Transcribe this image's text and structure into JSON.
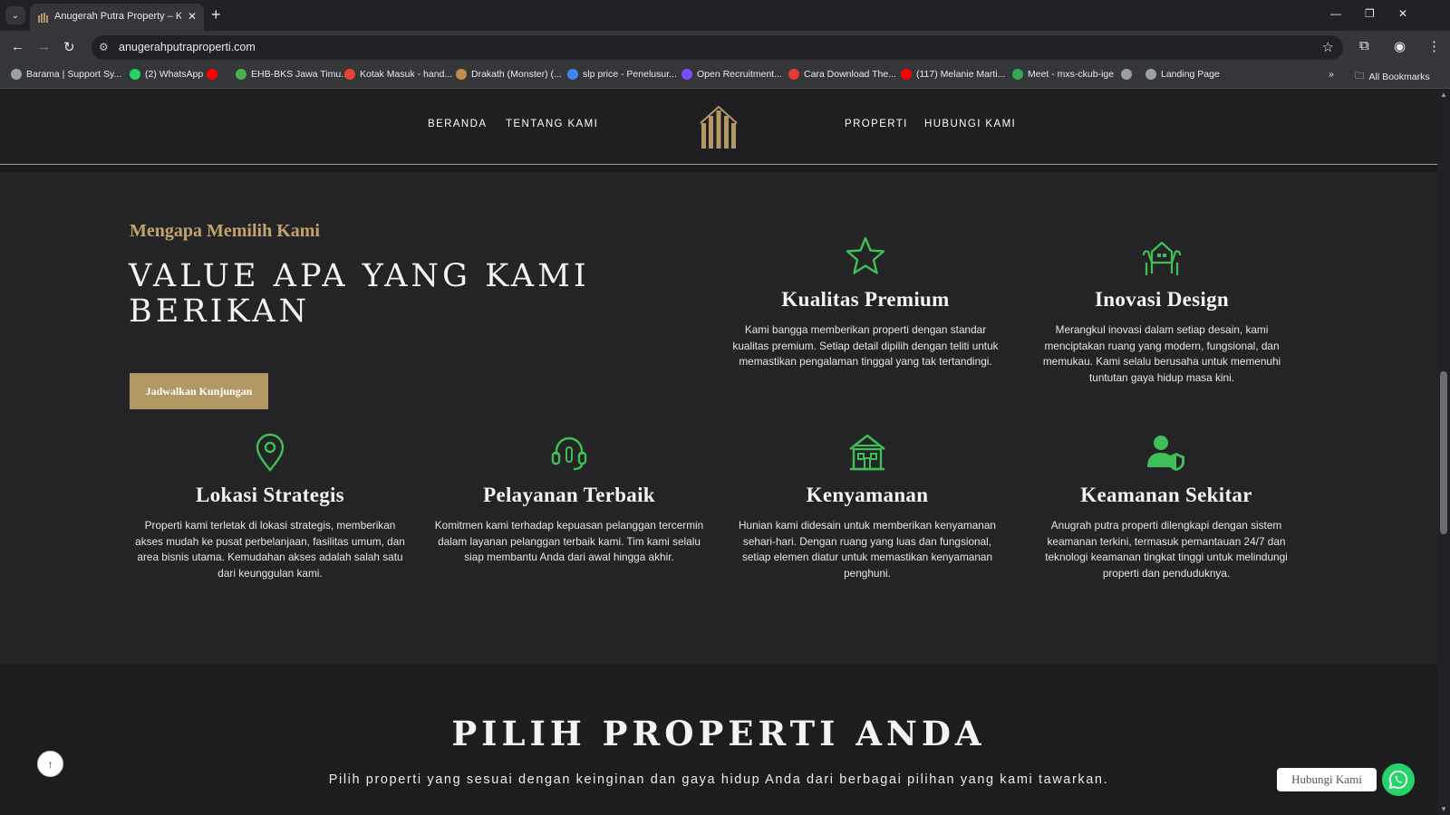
{
  "browser": {
    "tab_title": "Anugerah Putra Property – Kes",
    "url": "anugerahputraproperti.com",
    "bookmarks": [
      {
        "label": "Barama | Support Sy...",
        "icon": "globe-icon",
        "color": "#9aa0a6"
      },
      {
        "label": "(2) WhatsApp",
        "icon": "whatsapp-icon",
        "color": "#25d366"
      },
      {
        "label": "",
        "icon": "youtube-icon",
        "color": "#ff0000"
      },
      {
        "label": "EHB-BKS Jawa Timu...",
        "icon": "map-icon",
        "color": "#4caf50"
      },
      {
        "label": "Kotak Masuk - hand...",
        "icon": "gmail-icon",
        "color": "#ea4335"
      },
      {
        "label": "Drakath (Monster) (...",
        "icon": "avatar-icon",
        "color": "#c58b4a"
      },
      {
        "label": "slp price - Penelusur...",
        "icon": "google-icon",
        "color": "#4285f4"
      },
      {
        "label": "Open Recruitment...",
        "icon": "form-icon",
        "color": "#7c4dff"
      },
      {
        "label": "Cara Download The...",
        "icon": "s-icon",
        "color": "#e53935"
      },
      {
        "label": "(117) Melanie Marti...",
        "icon": "youtube-icon",
        "color": "#ff0000"
      },
      {
        "label": "Meet - mxs-ckub-ige",
        "icon": "meet-icon",
        "color": "#34a853"
      },
      {
        "label": "",
        "icon": "globe-icon",
        "color": "#9aa0a6"
      },
      {
        "label": "Landing Page",
        "icon": "globe-icon",
        "color": "#9aa0a6"
      }
    ],
    "all_bookmarks": "All Bookmarks"
  },
  "nav": {
    "beranda": "BERANDA",
    "tentang": "TENTANG KAMI",
    "properti": "PROPERTI",
    "hubungi": "HUBUNGI KAMI"
  },
  "values_section": {
    "eyebrow": "Mengapa Memilih Kami",
    "title": "VALUE APA YANG KAMI BERIKAN",
    "cta": "Jadwalkan Kunjungan",
    "icon_color": "#3fbf57",
    "features": [
      {
        "icon": "star-icon",
        "title": "Kualitas Premium",
        "desc": "Kami bangga memberikan properti dengan standar kualitas premium. Setiap detail dipilih dengan teliti untuk memastikan pengalaman tinggal yang tak tertandingi."
      },
      {
        "icon": "house-hands-icon",
        "title": "Inovasi Design",
        "desc": "Merangkul inovasi dalam setiap desain, kami menciptakan ruang yang modern, fungsional, dan memukau. Kami selalu berusaha untuk memenuhi tuntutan gaya hidup masa kini."
      },
      {
        "icon": "map-pin-icon",
        "title": "Lokasi Strategis",
        "desc": "Properti kami terletak di lokasi strategis, memberikan akses mudah ke pusat perbelanjaan, fasilitas umum, dan area bisnis utama. Kemudahan akses adalah salah satu dari keunggulan kami."
      },
      {
        "icon": "headset-icon",
        "title": "Pelayanan Terbaik",
        "desc": "Komitmen kami terhadap kepuasan pelanggan tercermin dalam layanan pelanggan terbaik kami. Tim kami selalu siap membantu Anda dari awal hingga akhir."
      },
      {
        "icon": "home-icon",
        "title": "Kenyamanan",
        "desc": "Hunian kami didesain untuk memberikan kenyamanan sehari-hari. Dengan ruang yang luas dan fungsional, setiap elemen diatur untuk memastikan kenyamanan penghuni."
      },
      {
        "icon": "user-shield-icon",
        "title": "Keamanan Sekitar",
        "desc": "Anugrah putra properti dilengkapi dengan sistem keamanan terkini, termasuk pemantauan 24/7 dan teknologi keamanan tingkat tinggi untuk melindungi properti dan penduduknya."
      }
    ]
  },
  "properties_section": {
    "title": "PILIH PROPERTI ANDA",
    "subtitle": "Pilih properti yang sesuai dengan keinginan dan gaya hidup Anda dari berbagai pilihan yang kami tawarkan."
  },
  "floating": {
    "whatsapp_label": "Hubungi Kami",
    "whatsapp_color": "#25d366",
    "to_top": "↑"
  }
}
